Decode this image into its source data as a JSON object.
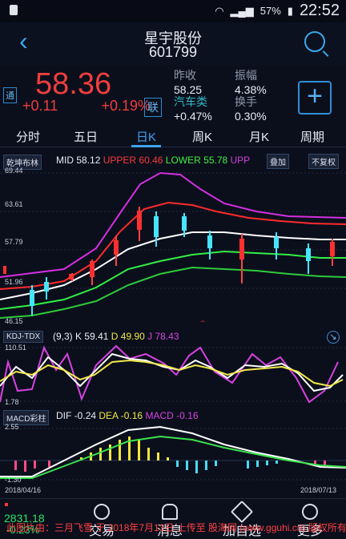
{
  "status": {
    "battery": "57%",
    "time": "22:52"
  },
  "header": {
    "title": "星宇股份",
    "code": "601799"
  },
  "quote": {
    "tag": "通",
    "price": "58.36",
    "change": "+0.11",
    "change_pct": "+0.19%",
    "lian": "联",
    "prev_close_label": "昨收",
    "prev_close": "58.25",
    "amplitude_label": "振幅",
    "amplitude": "4.38%",
    "sector_label": "汽车类",
    "sector_change": "+0.47%",
    "turnover_label": "换手",
    "turnover": "0.30%"
  },
  "tabs": [
    "分时",
    "五日",
    "日K",
    "周K",
    "月K",
    "周期"
  ],
  "main": {
    "indicator": "乾坤布林",
    "mid_label": "MID",
    "mid": "58.12",
    "upper_label": "UPPER",
    "upper": "60.46",
    "lower_label": "LOWER",
    "lower": "55.78",
    "upp_label": "UPP",
    "overlay": "叠加",
    "restore": "不复权",
    "ticks": [
      "69.44",
      "63.61",
      "57.79",
      "51.96",
      "46.15"
    ]
  },
  "kdj": {
    "label": "KDJ-TDX",
    "params": "(9,3)",
    "k_label": "K",
    "k": "59.41",
    "d_label": "D",
    "d": "49.90",
    "j_label": "J",
    "j": "78.43",
    "ticks": [
      "110.51",
      "1.78"
    ]
  },
  "macd": {
    "label": "MACD彩柱",
    "dif_label": "DIF",
    "dif": "-0.24",
    "dea_label": "DEA",
    "dea": "-0.16",
    "macd_label": "MACD",
    "macd": "-0.16",
    "ticks": [
      "2.55",
      "-1.30"
    ],
    "date_start": "2018/04/16",
    "date_end": "2018/07/13"
  },
  "bottom": {
    "index_value": "2831.18",
    "index_change": "-0.23%",
    "nav": [
      "交易",
      "消息",
      "加自选",
      "更多"
    ]
  },
  "watermark": "此图片由：三月飞雪 于 2018年7月13日 上传至 股海网 (www.gguhi.cn) 版权所有"
}
